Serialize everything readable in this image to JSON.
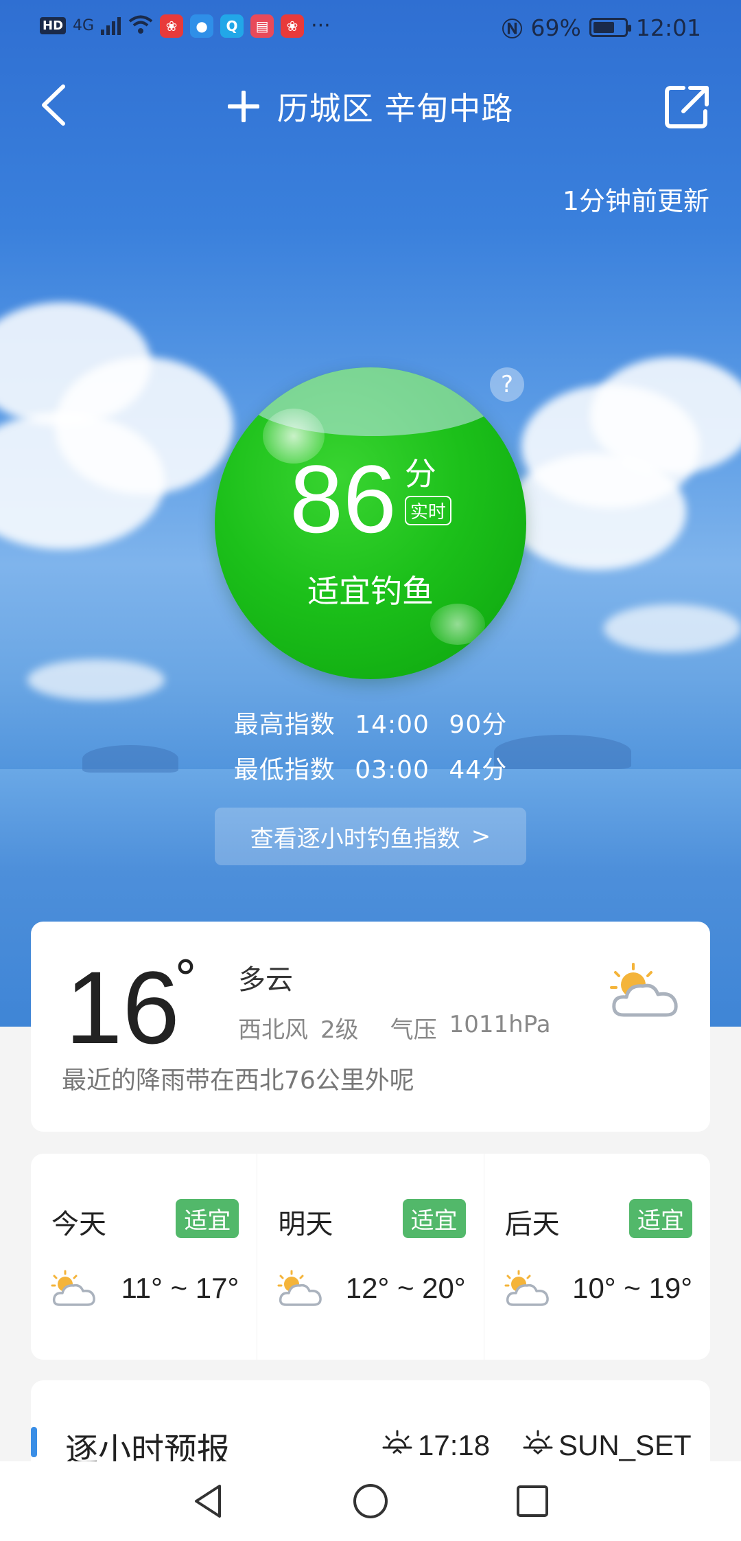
{
  "status_bar": {
    "time": "12:01",
    "battery_pct": "69%",
    "battery_level": 0.69,
    "network": "4G",
    "hd_label": "HD",
    "more": "···"
  },
  "header": {
    "location": "历城区 辛甸中路",
    "updated": "1分钟前更新"
  },
  "score": {
    "value": "86",
    "unit": "分",
    "badge": "实时",
    "status": "适宜钓鱼",
    "help": "?",
    "color": "#13b013"
  },
  "index": {
    "high_label": "最高指数",
    "high_time": "14:00",
    "high_value": "90分",
    "low_label": "最低指数",
    "low_time": "03:00",
    "low_value": "44分",
    "hourly_button": "查看逐小时钓鱼指数",
    "hourly_arrow": ">"
  },
  "now": {
    "temp": "16",
    "degree": "°",
    "condition": "多云",
    "wind": "西北风",
    "wind_level": "2级",
    "pressure_label": "气压",
    "pressure": "1011hPa",
    "rain_notice": "最近的降雨带在西北76公里外呢",
    "icon": "partly-cloudy-icon"
  },
  "forecast": [
    {
      "day": "今天",
      "tag": "适宜",
      "range": "11° ~ 17°",
      "icon": "partly-cloudy-icon"
    },
    {
      "day": "明天",
      "tag": "适宜",
      "range": "12° ~ 20°",
      "icon": "partly-cloudy-icon"
    },
    {
      "day": "后天",
      "tag": "适宜",
      "range": "10° ~ 19°",
      "icon": "partly-cloudy-icon"
    }
  ],
  "hourly": {
    "title": "逐小时预报",
    "sunrise": "17:18",
    "sunset": "SUN_SET"
  },
  "colors": {
    "tag_green": "#52b86a",
    "accent_blue": "#3a8ee6"
  }
}
